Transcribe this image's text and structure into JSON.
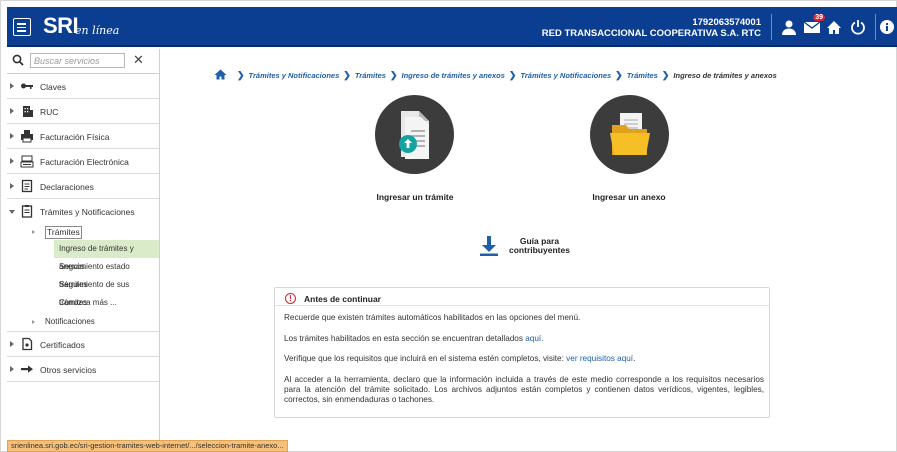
{
  "header": {
    "logo_main": "SRI",
    "logo_sub": "en línea",
    "ruc": "1792063574001",
    "company": "RED TRANSACCIONAL COOPERATIVA S.A. RTC",
    "notifications_count": "39",
    "icons": [
      "menu-icon",
      "user-icon",
      "mail-icon",
      "home-icon",
      "power-icon",
      "info-icon"
    ],
    "bg_color": "#0b3d91"
  },
  "sidebar": {
    "search_placeholder": "Buscar servicios",
    "items": [
      {
        "label": "Claves",
        "icon": "key-icon"
      },
      {
        "label": "RUC",
        "icon": "building-icon"
      },
      {
        "label": "Facturación Física",
        "icon": "printer-icon"
      },
      {
        "label": "Facturación Electrónica",
        "icon": "cash-register-icon"
      },
      {
        "label": "Declaraciones",
        "icon": "document-icon"
      },
      {
        "label": "Trámites y Notificaciones",
        "icon": "clipboard-icon"
      }
    ],
    "submenu_tramites": "Trámites",
    "leaves": [
      {
        "label": "Ingreso de trámites y anexos",
        "active": true
      },
      {
        "label": "Seguimiento estado trámites",
        "active": false
      },
      {
        "label": "Seguimiento de sus trámites",
        "active": false
      },
      {
        "label": "Conozca más ...",
        "active": false
      }
    ],
    "submenu_notificaciones": "Notificaciones",
    "bottom_items": [
      {
        "label": "Certificados",
        "icon": "certificate-icon"
      },
      {
        "label": "Otros servicios",
        "icon": "arrow-icon"
      }
    ],
    "active_color": "#d9ebc9"
  },
  "breadcrumb": [
    "Trámites y Notificaciones",
    "Trámites",
    "Ingreso de trámites y anexos",
    "Trámites y Notificaciones",
    "Trámites",
    "Ingreso de trámites y anexos"
  ],
  "cards": {
    "tramite": "Ingresar un trámite",
    "anexo": "Ingresar un anexo"
  },
  "guide": {
    "line1": "Guía para",
    "line2": "contribuyentes"
  },
  "notice": {
    "title": "Antes de continuar",
    "p1": "Recuerde que existen trámites automáticos habilitados en las opciones del menú.",
    "p2_text": "Los trámites habilitados en esta sección se encuentran detallados ",
    "p2_link": "aquí",
    "p2_end": ".",
    "p3_text": "Verifique que los requisitos que incluirá en el sistema estén completos, visite: ",
    "p3_link": "ver requisitos aquí",
    "p3_end": ".",
    "p4": "Al acceder a la herramienta, declaro que la información incluida a través de este medio corresponde a los requisitos necesarios para la atención del trámite solicitado. Los archivos adjuntos están completos y contienen datos verídicos, vigentes, legibles, correctos, sin enmendaduras o tachones."
  },
  "status_url": "srienlinea.sri.gob.ec/sri-gestion-tramites-web-internet/.../seleccion-tramite-anexo..."
}
